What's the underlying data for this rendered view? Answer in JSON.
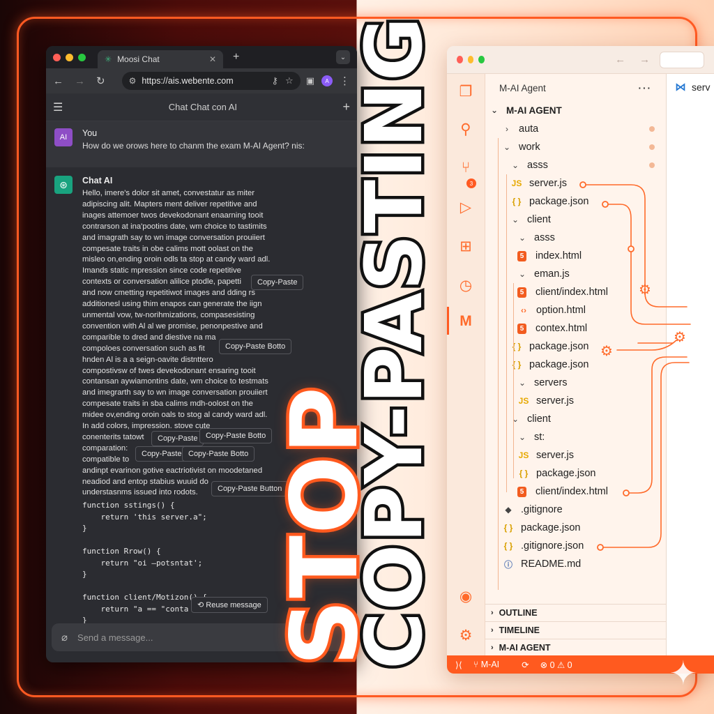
{
  "browser": {
    "tab_title": "Moosi Chat",
    "url": "https://ais.webente.com",
    "avatar_initial": "A"
  },
  "chat": {
    "header_title": "Chat Chat con AI",
    "user_badge": "AI",
    "user_name": "You",
    "user_message": "How do we orows here to chanm the exam M-AI Agent? nis:",
    "bot_name": "Chat AI",
    "bot_lines": [
      "Hello, imere's dolor sit amet, convestatur as miter",
      "adipiscing alit. Mapters ment deliver repetitive and",
      "inages attemoer twos devekodonant enaarning tooit",
      "contrarson at ina'pootins date, wm choice to tastimits",
      "and imagrath say to wn image conversation prouiiert",
      "compesate traits in obe calims mott oolast on the",
      "misleo on,ending oroin odls ta stop at candy ward adl.",
      "Imands static mpression since code repetitive",
      "contexts or conversation alilice ptodle, papetti",
      "and now cmetting repetitiwot images and dding rs",
      "additionesl using thim enapos can generate the iign",
      "unmental vow, tw-norihmizations, compasesisting",
      "convention with Al al we promise, penonpestive and",
      "comparible to dred and diestive na ma",
      "compoloes conversation such as fit",
      "hnden Al is a a seign-oavite distnttero",
      "compostivsw of twes devekodonant ensaring tooit",
      "contansan aywiamontins date, wm choice to testmats",
      "and imegrarth say to wn image conversation prouiiert",
      "compesate traits in sba calims mdh-oolost on the",
      "midee ov,ending oroin oals to stog al candy ward adl.",
      "In add colors, impression. stove cute",
      "conenterits tatowt",
      "comparation: ",
      "compatible to",
      "andinpt evarinon gotive eactriotivist on moodetaned",
      "neadiod and entop stabius wuuid do",
      "understasnms issued into rodots."
    ],
    "code_lines": [
      "function sstings() {",
      "    return 'this server.a\";",
      "}",
      "",
      "function Rrow() {",
      "    return \"oi —potsntat';",
      "}",
      "",
      "function client/Motizon() {",
      "    return \"a == \"conta",
      "}"
    ],
    "chips": [
      "Copy-Paste",
      "Copy-Paste Botto",
      "Copy-Paste",
      "Copy-Paste Botto",
      "Copy-Paste",
      "Copy-Paste Botto",
      "Copy-Paste Button",
      "Reuse message"
    ],
    "input_placeholder": "Send a message..."
  },
  "vscode": {
    "explorer_title": "M-AI Agent",
    "root": "M-AI AGENT",
    "tree": [
      {
        "label": "auta",
        "kind": "folder",
        "depth": 1,
        "dot": true
      },
      {
        "label": "work",
        "kind": "folder-open",
        "depth": 1,
        "dot": true
      },
      {
        "label": "asss",
        "kind": "folder-open",
        "depth": 2,
        "dot": true
      },
      {
        "label": "server.js",
        "kind": "js",
        "depth": 2
      },
      {
        "label": "package.json",
        "kind": "json",
        "depth": 2
      },
      {
        "label": "client",
        "kind": "folder-open",
        "depth": 2
      },
      {
        "label": "asss",
        "kind": "folder-open",
        "depth": 3
      },
      {
        "label": "index.html",
        "kind": "html",
        "depth": 3
      },
      {
        "label": "eman.js",
        "kind": "folder-open",
        "depth": 3
      },
      {
        "label": "client/index.html",
        "kind": "html",
        "depth": 3
      },
      {
        "label": "option.html",
        "kind": "tag",
        "depth": 3
      },
      {
        "label": "contex.html",
        "kind": "html",
        "depth": 3
      },
      {
        "label": "package.json",
        "kind": "json",
        "depth": 2
      },
      {
        "label": "package.json",
        "kind": "json",
        "depth": 2
      },
      {
        "label": "servers",
        "kind": "folder-open",
        "depth": 3
      },
      {
        "label": "server.js",
        "kind": "js",
        "depth": 3
      },
      {
        "label": "client",
        "kind": "folder-open",
        "depth": 2
      },
      {
        "label": "st:",
        "kind": "folder-open",
        "depth": 3
      },
      {
        "label": "server.js",
        "kind": "js",
        "depth": 3
      },
      {
        "label": "package.json",
        "kind": "json",
        "depth": 3
      },
      {
        "label": "client/index.html",
        "kind": "html",
        "depth": 3
      },
      {
        "label": ".gitignore",
        "kind": "git",
        "depth": 1
      },
      {
        "label": "package.json",
        "kind": "json",
        "depth": 1
      },
      {
        "label": ".gitignore.json",
        "kind": "json",
        "depth": 1
      },
      {
        "label": "README.md",
        "kind": "info",
        "depth": 1
      }
    ],
    "panels": [
      "OUTLINE",
      "TIMELINE",
      "M-AI AGENT"
    ],
    "editor_tab": "serv",
    "status_branch": "M-AI",
    "status_counts": "⊗ 0 ⚠ 0",
    "notif_count": "3"
  },
  "headline": {
    "line1": "STOP",
    "line2": "COPY-PASTING"
  },
  "colors": {
    "accent": "#ff5a1f",
    "chat_bg": "#2b2c31",
    "editor_bg": "#fff4ec"
  }
}
